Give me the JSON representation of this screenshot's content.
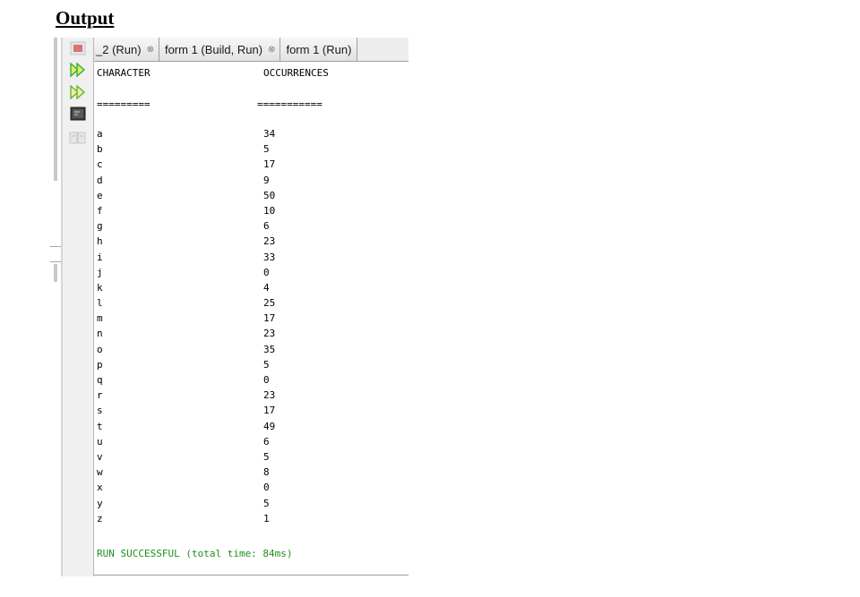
{
  "heading": "Output",
  "tabs": [
    {
      "label": "_2 (Run)",
      "close": "⊗"
    },
    {
      "label": "form 1 (Build, Run)",
      "close": "⊗"
    },
    {
      "label": "form 1 (Run)",
      "close": ""
    }
  ],
  "toolbar": {
    "tools": [
      {
        "name": "rerun-icon"
      },
      {
        "name": "rerun-with-options-icon"
      },
      {
        "name": "terminal-icon"
      },
      {
        "name": "clear-output-icon"
      }
    ]
  },
  "console": {
    "header_character": "CHARACTER",
    "header_occurrences": "OCCURRENCES",
    "underline_character": "=========",
    "underline_occurrences": "===========",
    "rows": [
      {
        "ch": "a",
        "count": "34"
      },
      {
        "ch": "b",
        "count": "5"
      },
      {
        "ch": "c",
        "count": "17"
      },
      {
        "ch": "d",
        "count": "9"
      },
      {
        "ch": "e",
        "count": "50"
      },
      {
        "ch": "f",
        "count": "10"
      },
      {
        "ch": "g",
        "count": "6"
      },
      {
        "ch": "h",
        "count": "23"
      },
      {
        "ch": "i",
        "count": "33"
      },
      {
        "ch": "j",
        "count": "0"
      },
      {
        "ch": "k",
        "count": "4"
      },
      {
        "ch": "l",
        "count": "25"
      },
      {
        "ch": "m",
        "count": "17"
      },
      {
        "ch": "n",
        "count": "23"
      },
      {
        "ch": "o",
        "count": "35"
      },
      {
        "ch": "p",
        "count": "5"
      },
      {
        "ch": "q",
        "count": "0"
      },
      {
        "ch": "r",
        "count": "23"
      },
      {
        "ch": "s",
        "count": "17"
      },
      {
        "ch": "t",
        "count": "49"
      },
      {
        "ch": "u",
        "count": "6"
      },
      {
        "ch": "v",
        "count": "5"
      },
      {
        "ch": "w",
        "count": "8"
      },
      {
        "ch": "x",
        "count": "0"
      },
      {
        "ch": "y",
        "count": "5"
      },
      {
        "ch": "z",
        "count": "1"
      }
    ],
    "status": "RUN SUCCESSFUL (total time: 84ms)"
  },
  "colors": {
    "success": "#1f8f1f",
    "run_icon": "#3aa83a",
    "run_icon_fill": "#d8ef6a"
  }
}
